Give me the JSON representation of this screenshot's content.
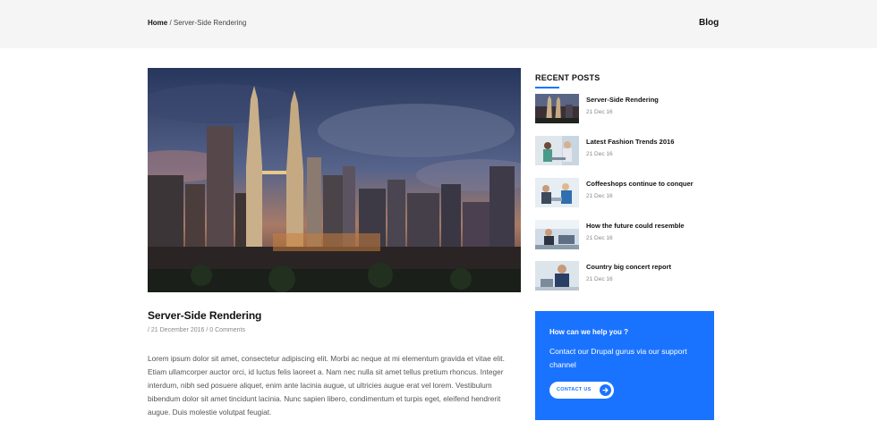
{
  "breadcrumb": {
    "home": "Home",
    "separator": " / ",
    "current": "Server-Side Rendering"
  },
  "header": {
    "page_label": "Blog"
  },
  "post": {
    "title": "Server-Side Rendering",
    "meta_prefix": " / ",
    "date": "21 December 2016",
    "meta_sep": " / ",
    "comments": "0 Comments",
    "body": "Lorem ipsum dolor sit amet, consectetur adipiscing elit. Morbi ac neque at mi elementum gravida et vitae elit. Etiam ullamcorper auctor orci, id luctus felis laoreet a. Nam nec nulla sit amet tellus pretium rhoncus. Integer interdum, nibh sed posuere aliquet, enim ante lacinia augue, ut ultricies augue erat vel lorem. Vestibulum bibendum dolor sit amet tincidunt lacinia. Nunc sapien libero, condimentum et turpis eget, eleifend hendrerit augue. Duis molestie volutpat feugiat."
  },
  "sidebar": {
    "heading": "RECENT POSTS",
    "items": [
      {
        "title": "Server-Side Rendering",
        "date": "21 Dec 16"
      },
      {
        "title": "Latest Fashion Trends 2016",
        "date": "21 Dec 16"
      },
      {
        "title": "Coffeeshops continue to conquer",
        "date": "21 Dec 16"
      },
      {
        "title": "How the future could resemble",
        "date": "21 Dec 16"
      },
      {
        "title": "Country big concert report",
        "date": "21 Dec 16"
      }
    ]
  },
  "help_box": {
    "title": "How can we help you ?",
    "text": "Contact our Drupal gurus via our support channel",
    "button_label": "CONTACT US",
    "color": "#1a73ff"
  },
  "icons": {
    "button_arrow": "arrow-right-icon"
  }
}
